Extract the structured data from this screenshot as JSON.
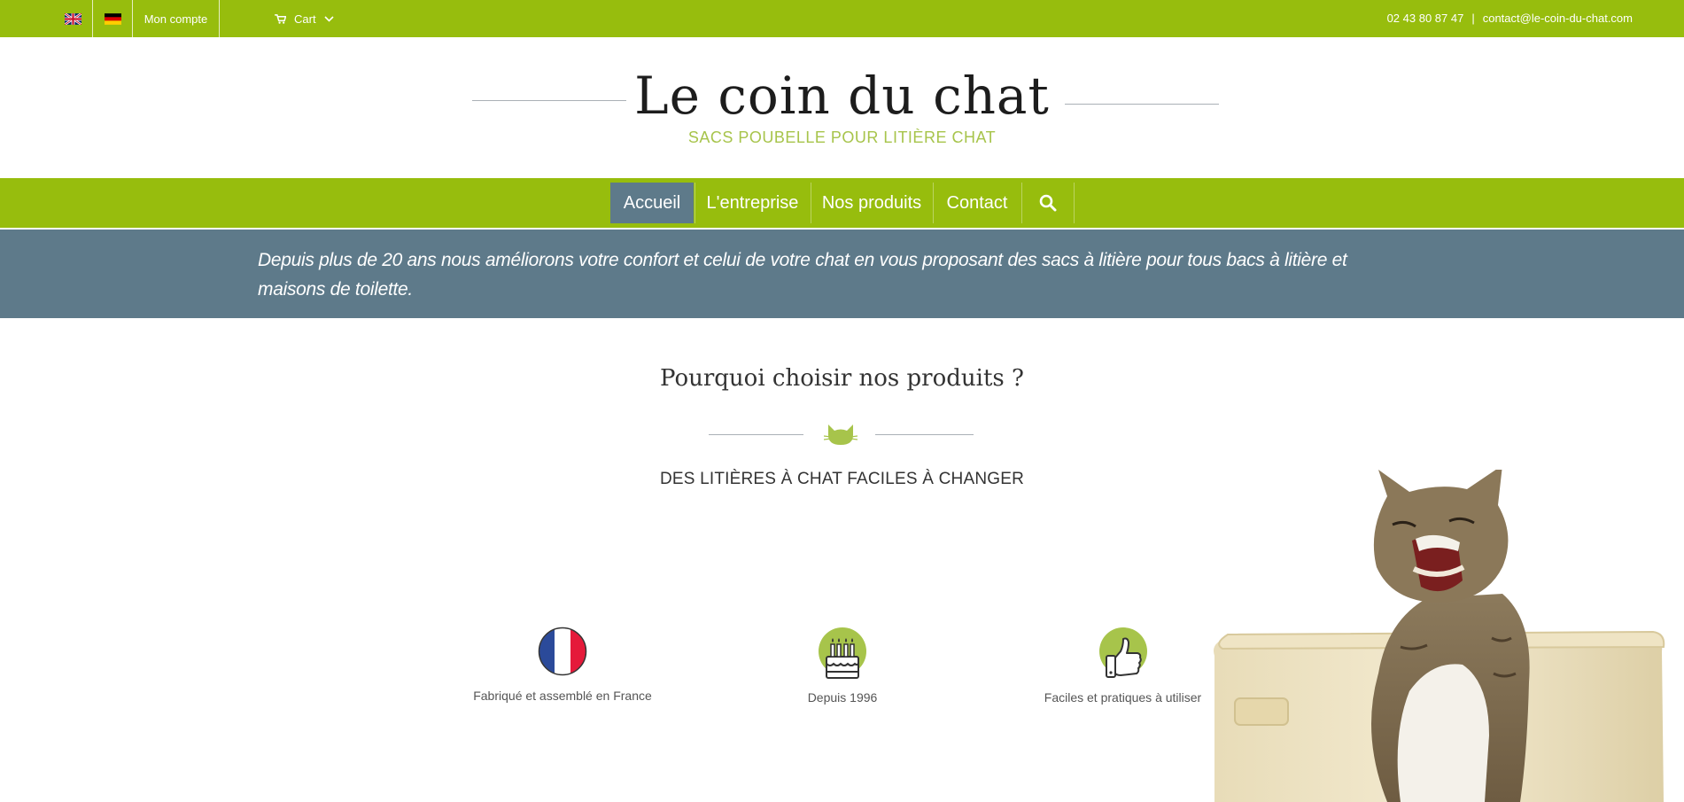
{
  "topbar": {
    "languages": [
      {
        "name": "english",
        "icon": "flag-uk-icon"
      },
      {
        "name": "german",
        "icon": "flag-de-icon"
      }
    ],
    "account_label": "Mon compte",
    "cart_label": "Cart",
    "phone": "02 43 80 87 47",
    "separator": "|",
    "email": "contact@le-coin-du-chat.com"
  },
  "header": {
    "title": "Le coin du chat",
    "tagline": "SACS POUBELLE POUR LITIÈRE CHAT"
  },
  "nav": {
    "items": [
      {
        "label": "Accueil",
        "active": true
      },
      {
        "label": "L'entreprise",
        "active": false
      },
      {
        "label": "Nos produits",
        "active": false
      },
      {
        "label": "Contact",
        "active": false
      }
    ],
    "search_icon": "search-icon"
  },
  "banner": {
    "text": "Depuis plus de 20 ans nous améliorons votre confort et celui de votre chat en vous proposant des sacs à litière pour tous bacs à litière et maisons de toilette."
  },
  "section": {
    "title": "Pourquoi choisir nos produits ?",
    "subtitle": "DES LITIÈRES À CHAT FACILES À CHANGER"
  },
  "features": [
    {
      "label": "Fabriqué et assemblé en France",
      "icon": "france-flag-icon"
    },
    {
      "label": "Depuis 1996",
      "icon": "birthday-cake-icon"
    },
    {
      "label": "Faciles et pratiques à utiliser",
      "icon": "thumbs-up-icon"
    }
  ],
  "colors": {
    "brand_green": "#97bd0d",
    "slate": "#5e7a8a",
    "light_green": "#a7c44b"
  }
}
